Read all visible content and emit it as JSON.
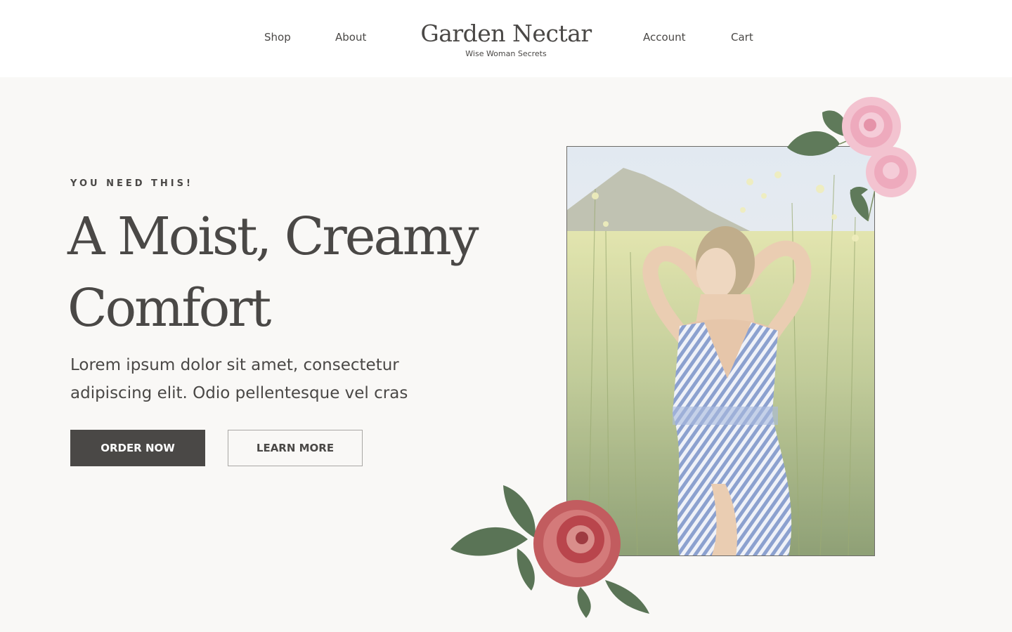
{
  "nav": {
    "left": [
      {
        "label": "Shop"
      },
      {
        "label": "About"
      }
    ],
    "right": [
      {
        "label": "Account"
      },
      {
        "label": "Cart"
      }
    ]
  },
  "brand": {
    "name": "Garden Nectar",
    "tagline": "Wise Woman Secrets"
  },
  "hero": {
    "eyebrow": "YOU NEED THIS!",
    "headline": "A Moist, Creamy Comfort",
    "body": "Lorem ipsum dolor sit amet, consectetur adipiscing elit. Odio pellentesque vel cras",
    "primary_button": "ORDER NOW",
    "secondary_button": "LEARN MORE"
  },
  "colors": {
    "text": "#4a4846",
    "background": "#f9f8f6",
    "header_background": "#ffffff",
    "primary_button": "#4a4846"
  },
  "images": {
    "hero_photo": "woman-in-striped-dress-in-flower-field",
    "top_flowers": "pink-roses-illustration",
    "bottom_flower": "red-peony-illustration"
  }
}
